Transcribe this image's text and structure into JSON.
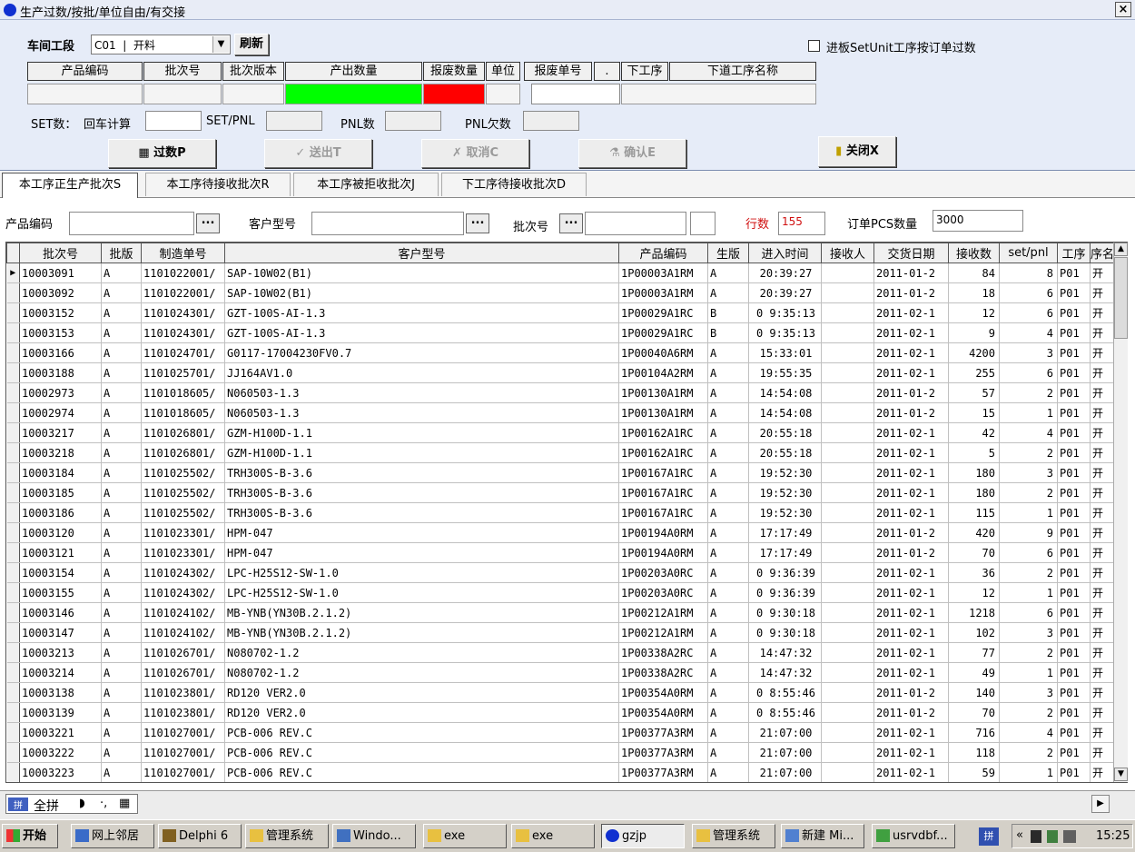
{
  "window": {
    "title": "生产过数/按批/单位自由/有交接",
    "close_label": "×"
  },
  "top": {
    "workshop_label": "车间工段",
    "workshop_value": "C01  |  开料",
    "refresh_label": "刷新",
    "checkbox_label": "进板SetUnit工序按订单过数",
    "info_headers": [
      "产品编码",
      "批次号",
      "批次版本",
      "产出数量",
      "报废数量",
      "单位",
      "报废单号",
      "下工序",
      "下道工序名称"
    ],
    "report_dots": ".",
    "set_label": "SET数：",
    "back_calc_label": "回车计算",
    "set_pnl_label": "SET/PNL",
    "pnl_label": "PNL数",
    "pnl_short_label": "PNL欠数",
    "buttons": {
      "count": "过数P",
      "send": "送出T",
      "cancel": "取消C",
      "confirm": "确认E",
      "close": "关闭X"
    },
    "colors": {
      "output": "#00ff00",
      "scrap": "#ff0000"
    }
  },
  "tabs": [
    "本工序正生产批次S",
    "本工序待接收批次R",
    "本工序被拒收批次J",
    "下工序待接收批次D"
  ],
  "filters": {
    "product_code_label": "产品编码",
    "customer_model_label": "客户型号",
    "batch_label": "批次号",
    "dots": "...",
    "row_count_label": "行数",
    "row_count_value": "155",
    "order_pcs_label": "订单PCS数量",
    "order_pcs_value": "3000"
  },
  "grid": {
    "columns": [
      "批次号",
      "批版",
      "制造单号",
      "客户型号",
      "产品编码",
      "生版",
      "进入时间",
      "接收人",
      "交货日期",
      "接收数",
      "set/pnl",
      "工序",
      "序名"
    ],
    "rows": [
      [
        "10003091",
        "A",
        "1101022001/",
        "SAP-10W02(B1)",
        "1P00003A1RM",
        "A",
        "20:39:27",
        "",
        "2011-01-2",
        "84",
        "8",
        "P01",
        "开"
      ],
      [
        "10003092",
        "A",
        "1101022001/",
        "SAP-10W02(B1)",
        "1P00003A1RM",
        "A",
        "20:39:27",
        "",
        "2011-01-2",
        "18",
        "6",
        "P01",
        "开"
      ],
      [
        "10003152",
        "A",
        "1101024301/",
        "GZT-100S-AI-1.3",
        "1P00029A1RC",
        "B",
        "0 9:35:13",
        "",
        "2011-02-1",
        "12",
        "6",
        "P01",
        "开"
      ],
      [
        "10003153",
        "A",
        "1101024301/",
        "GZT-100S-AI-1.3",
        "1P00029A1RC",
        "B",
        "0 9:35:13",
        "",
        "2011-02-1",
        "9",
        "4",
        "P01",
        "开"
      ],
      [
        "10003166",
        "A",
        "1101024701/",
        "G0117-17004230FV0.7",
        "1P00040A6RM",
        "A",
        "15:33:01",
        "",
        "2011-02-1",
        "4200",
        "3",
        "P01",
        "开"
      ],
      [
        "10003188",
        "A",
        "1101025701/",
        "JJ164AV1.0",
        "1P00104A2RM",
        "A",
        "19:55:35",
        "",
        "2011-02-1",
        "255",
        "6",
        "P01",
        "开"
      ],
      [
        "10002973",
        "A",
        "1101018605/",
        "N060503-1.3",
        "1P00130A1RM",
        "A",
        "14:54:08",
        "",
        "2011-01-2",
        "57",
        "2",
        "P01",
        "开"
      ],
      [
        "10002974",
        "A",
        "1101018605/",
        "N060503-1.3",
        "1P00130A1RM",
        "A",
        "14:54:08",
        "",
        "2011-01-2",
        "15",
        "1",
        "P01",
        "开"
      ],
      [
        "10003217",
        "A",
        "1101026801/",
        "GZM-H100D-1.1",
        "1P00162A1RC",
        "A",
        "20:55:18",
        "",
        "2011-02-1",
        "42",
        "4",
        "P01",
        "开"
      ],
      [
        "10003218",
        "A",
        "1101026801/",
        "GZM-H100D-1.1",
        "1P00162A1RC",
        "A",
        "20:55:18",
        "",
        "2011-02-1",
        "5",
        "2",
        "P01",
        "开"
      ],
      [
        "10003184",
        "A",
        "1101025502/",
        "TRH300S-B-3.6",
        "1P00167A1RC",
        "A",
        "19:52:30",
        "",
        "2011-02-1",
        "180",
        "3",
        "P01",
        "开"
      ],
      [
        "10003185",
        "A",
        "1101025502/",
        "TRH300S-B-3.6",
        "1P00167A1RC",
        "A",
        "19:52:30",
        "",
        "2011-02-1",
        "180",
        "2",
        "P01",
        "开"
      ],
      [
        "10003186",
        "A",
        "1101025502/",
        "TRH300S-B-3.6",
        "1P00167A1RC",
        "A",
        "19:52:30",
        "",
        "2011-02-1",
        "115",
        "1",
        "P01",
        "开"
      ],
      [
        "10003120",
        "A",
        "1101023301/",
        "HPM-047",
        "1P00194A0RM",
        "A",
        "17:17:49",
        "",
        "2011-01-2",
        "420",
        "9",
        "P01",
        "开"
      ],
      [
        "10003121",
        "A",
        "1101023301/",
        "HPM-047",
        "1P00194A0RM",
        "A",
        "17:17:49",
        "",
        "2011-01-2",
        "70",
        "6",
        "P01",
        "开"
      ],
      [
        "10003154",
        "A",
        "1101024302/",
        "LPC-H25S12-SW-1.0",
        "1P00203A0RC",
        "A",
        "0 9:36:39",
        "",
        "2011-02-1",
        "36",
        "2",
        "P01",
        "开"
      ],
      [
        "10003155",
        "A",
        "1101024302/",
        "LPC-H25S12-SW-1.0",
        "1P00203A0RC",
        "A",
        "0 9:36:39",
        "",
        "2011-02-1",
        "12",
        "1",
        "P01",
        "开"
      ],
      [
        "10003146",
        "A",
        "1101024102/",
        "MB-YNB(YN30B.2.1.2)",
        "1P00212A1RM",
        "A",
        "0 9:30:18",
        "",
        "2011-02-1",
        "1218",
        "6",
        "P01",
        "开"
      ],
      [
        "10003147",
        "A",
        "1101024102/",
        "MB-YNB(YN30B.2.1.2)",
        "1P00212A1RM",
        "A",
        "0 9:30:18",
        "",
        "2011-02-1",
        "102",
        "3",
        "P01",
        "开"
      ],
      [
        "10003213",
        "A",
        "1101026701/",
        "N080702-1.2",
        "1P00338A2RC",
        "A",
        "14:47:32",
        "",
        "2011-02-1",
        "77",
        "2",
        "P01",
        "开"
      ],
      [
        "10003214",
        "A",
        "1101026701/",
        "N080702-1.2",
        "1P00338A2RC",
        "A",
        "14:47:32",
        "",
        "2011-02-1",
        "49",
        "1",
        "P01",
        "开"
      ],
      [
        "10003138",
        "A",
        "1101023801/",
        "RD120 VER2.0",
        "1P00354A0RM",
        "A",
        "0 8:55:46",
        "",
        "2011-01-2",
        "140",
        "3",
        "P01",
        "开"
      ],
      [
        "10003139",
        "A",
        "1101023801/",
        "RD120 VER2.0",
        "1P00354A0RM",
        "A",
        "0 8:55:46",
        "",
        "2011-01-2",
        "70",
        "2",
        "P01",
        "开"
      ],
      [
        "10003221",
        "A",
        "1101027001/",
        "PCB-006 REV.C",
        "1P00377A3RM",
        "A",
        "21:07:00",
        "",
        "2011-02-1",
        "716",
        "4",
        "P01",
        "开"
      ],
      [
        "10003222",
        "A",
        "1101027001/",
        "PCB-006 REV.C",
        "1P00377A3RM",
        "A",
        "21:07:00",
        "",
        "2011-02-1",
        "118",
        "2",
        "P01",
        "开"
      ],
      [
        "10003223",
        "A",
        "1101027001/",
        "PCB-006 REV.C",
        "1P00377A3RM",
        "A",
        "21:07:00",
        "",
        "2011-02-1",
        "59",
        "1",
        "P01",
        "开"
      ]
    ]
  },
  "ime": {
    "mode": "全拼"
  },
  "taskbar": {
    "start": "开始",
    "items": [
      "网上邻居",
      "Delphi 6",
      "管理系统",
      "Windo...",
      "exe",
      "exe",
      "gzjp",
      "管理系统",
      "新建 Mi...",
      "usrvdbf..."
    ],
    "clock": "15:25",
    "tray_chevron": "«"
  }
}
